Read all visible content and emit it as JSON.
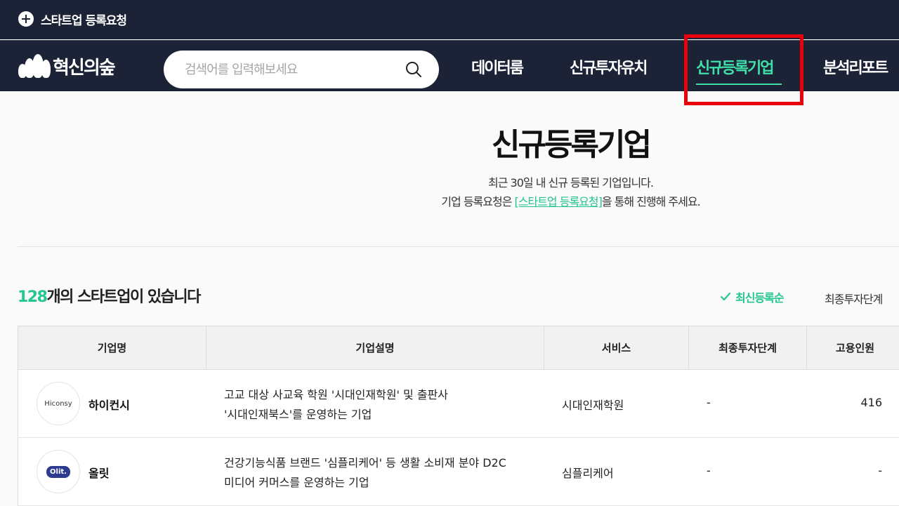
{
  "topbar": {
    "request_label": "스타트업 등록요청"
  },
  "header": {
    "logo_text": "혁신의숲",
    "search_placeholder": "검색어를 입력해보세요",
    "nav": [
      {
        "label": "데이터룸"
      },
      {
        "label": "신규투자유치"
      },
      {
        "label": "신규등록기업"
      },
      {
        "label": "분석리포트"
      }
    ]
  },
  "main": {
    "title": "신규등록기업",
    "desc_line1": "최근 30일 내 신규 등록된 기업입니다.",
    "desc_line2_prefix": "기업 등록요청은 ",
    "desc_line2_link": "[스타트업 등록요청]",
    "desc_line2_suffix": "을 통해 진행해 주세요.",
    "count_number": "128",
    "count_suffix": "개의 스타트업이 있습니다",
    "sort_latest": "최신등록순",
    "sort_invest": "최종투자단계"
  },
  "table": {
    "columns": [
      "기업명",
      "기업설명",
      "서비스",
      "최종투자단계",
      "고용인원"
    ],
    "rows": [
      {
        "logo": "Hiconsy",
        "name": "하이컨시",
        "desc_line1": "고교 대상 사교육 학원 '시대인재학원' 및 출판사",
        "desc_line2": "'시대인재북스'를 운영하는 기업",
        "service": "시대인재학원",
        "stage": "-",
        "employees": "416"
      },
      {
        "logo": "Olit.",
        "name": "올릿",
        "desc_line1": "건강기능식품 브랜드 '심플리케어' 등 생활 소비재 분야 D2C",
        "desc_line2": "미디어 커머스를 운영하는 기업",
        "service": "심플리케어",
        "stage": "-",
        "employees": "-"
      }
    ]
  },
  "colors": {
    "accent": "#3ee0a8",
    "link": "#23c78d",
    "header_bg": "#1d2336",
    "highlight": "#e8000b"
  }
}
